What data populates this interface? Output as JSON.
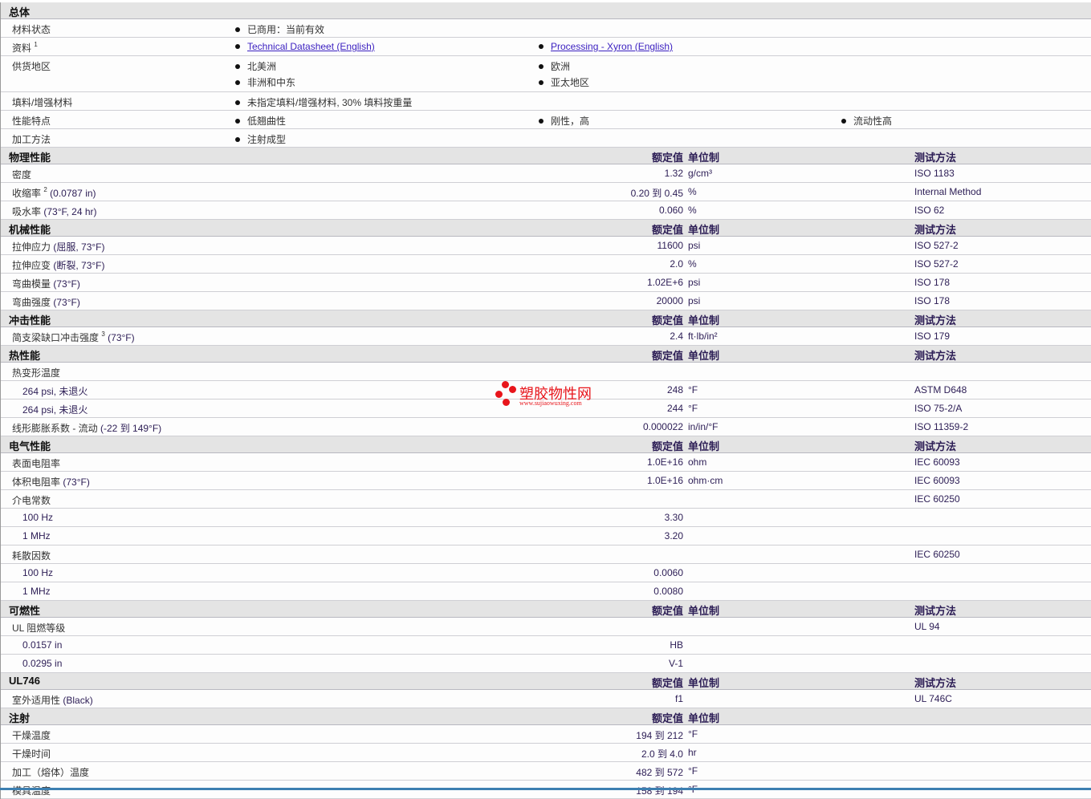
{
  "colors": {
    "header_bg": "#e4e4e4",
    "value": "#2c1d55",
    "link": "#3a1fc0",
    "watermark": "#e8151b"
  },
  "general": {
    "title": "总体",
    "rows": [
      {
        "label": "材料状态",
        "items": [
          [
            "已商用：当前有效"
          ]
        ]
      },
      {
        "label": "资料",
        "sup": "1",
        "links": true,
        "items": [
          [
            "Technical Datasheet (English)"
          ],
          [
            "Processing - Xyron (English)"
          ]
        ]
      },
      {
        "label": "供货地区",
        "tall": true,
        "items": [
          [
            "北美洲",
            "非洲和中东"
          ],
          [
            "欧洲",
            "亚太地区"
          ]
        ]
      },
      {
        "label": "填料/增强材料",
        "items": [
          [
            "未指定填料/增强材料, 30% 填料按重量"
          ]
        ]
      },
      {
        "label": "性能特点",
        "items": [
          [
            "低翘曲性"
          ],
          [
            "刚性，高"
          ],
          [
            "流动性高"
          ]
        ]
      },
      {
        "label": "加工方法",
        "items": [
          [
            "注射成型"
          ]
        ]
      }
    ]
  },
  "columns": {
    "value": "额定值",
    "unit": "单位制",
    "test": "测试方法"
  },
  "sections": [
    {
      "title": "物理性能",
      "test_col": true,
      "rows": [
        {
          "label": "密度",
          "value": "1.32",
          "unit": "g/cm³",
          "test": "ISO 1183"
        },
        {
          "label": "收缩率",
          "sup": "2",
          "cond": "(0.0787 in)",
          "value": "0.20 到  0.45",
          "unit": "%",
          "test": "Internal Method"
        },
        {
          "label": "吸水率",
          "cond": "(73°F, 24 hr)",
          "value": "0.060",
          "unit": "%",
          "test": "ISO 62"
        }
      ]
    },
    {
      "title": "机械性能",
      "test_col": true,
      "rows": [
        {
          "label": "拉伸应力",
          "cond": "(屈服, 73°F)",
          "value": "11600",
          "unit": "psi",
          "test": "ISO 527-2"
        },
        {
          "label": "拉伸应变",
          "cond": "(断裂, 73°F)",
          "value": "2.0",
          "unit": "%",
          "test": "ISO 527-2"
        },
        {
          "label": "弯曲模量",
          "cond": "(73°F)",
          "value": "1.02E+6",
          "unit": "psi",
          "test": "ISO 178"
        },
        {
          "label": "弯曲强度",
          "cond": "(73°F)",
          "value": "20000",
          "unit": "psi",
          "test": "ISO 178"
        }
      ]
    },
    {
      "title": "冲击性能",
      "test_col": true,
      "rows": [
        {
          "label": "简支梁缺口冲击强度",
          "sup": "3",
          "cond": "(73°F)",
          "value": "2.4",
          "unit": "ft·lb/in²",
          "test": "ISO 179"
        }
      ]
    },
    {
      "title": "热性能",
      "test_col": true,
      "rows": [
        {
          "label": "热变形温度"
        },
        {
          "label": "264 psi, 未退火",
          "sub": true,
          "value": "248",
          "unit": "°F",
          "test": "ASTM D648"
        },
        {
          "label": "264 psi, 未退火",
          "sub": true,
          "value": "244",
          "unit": "°F",
          "test": "ISO 75-2/A"
        },
        {
          "label": "线形膨胀系数 - 流动",
          "cond": "(-22 到  149°F)",
          "value": "0.000022",
          "unit": "in/in/°F",
          "test": "ISO 11359-2"
        }
      ]
    },
    {
      "title": "电气性能",
      "test_col": true,
      "rows": [
        {
          "label": "表面电阻率",
          "value": "1.0E+16",
          "unit": "ohm",
          "test": "IEC 60093"
        },
        {
          "label": "体积电阻率",
          "cond": "(73°F)",
          "value": "1.0E+16",
          "unit": "ohm·cm",
          "test": "IEC 60093"
        },
        {
          "label": "介电常数",
          "test": "IEC 60250"
        },
        {
          "label": "100 Hz",
          "sub": true,
          "value": "3.30"
        },
        {
          "label": "1 MHz",
          "sub": true,
          "value": "3.20"
        },
        {
          "label": "耗散因数",
          "test": "IEC 60250"
        },
        {
          "label": "100 Hz",
          "sub": true,
          "value": "0.0060"
        },
        {
          "label": "1 MHz",
          "sub": true,
          "value": "0.0080"
        }
      ]
    },
    {
      "title": "可燃性",
      "test_col": true,
      "rows": [
        {
          "label": "UL 阻燃等级",
          "test": "UL 94"
        },
        {
          "label": "0.0157 in",
          "sub": true,
          "value": "HB"
        },
        {
          "label": "0.0295 in",
          "sub": true,
          "value": "V-1"
        }
      ]
    },
    {
      "title": "UL746",
      "test_col": true,
      "rows": [
        {
          "label": "室外适用性",
          "cond": "(Black)",
          "value": "f1",
          "test": "UL 746C"
        }
      ]
    },
    {
      "title": "注射",
      "test_col": false,
      "rows": [
        {
          "label": "干燥温度",
          "value": "194 到  212",
          "unit": "°F"
        },
        {
          "label": "干燥时间",
          "value": "2.0 到  4.0",
          "unit": "hr"
        },
        {
          "label": "加工（熔体）温度",
          "value": "482 到  572",
          "unit": "°F"
        },
        {
          "label": "模具温度",
          "value": "158 到  194",
          "unit": "°F"
        }
      ]
    }
  ],
  "watermark": {
    "name": "塑胶物性网",
    "url": "www.sujiaowuxing.com"
  }
}
